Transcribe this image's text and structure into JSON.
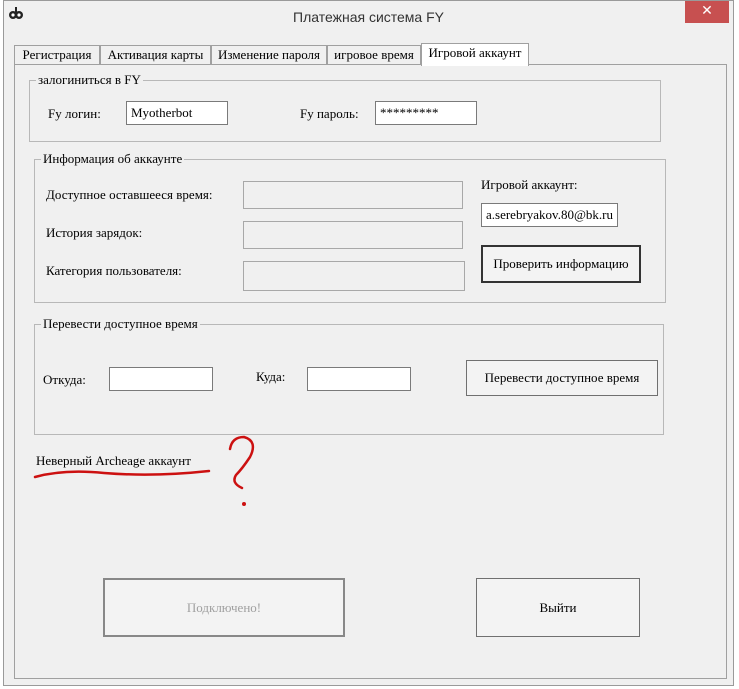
{
  "window": {
    "title": "Платежная система FY",
    "close_glyph": "✕"
  },
  "tabs": [
    {
      "label": "Регистрация"
    },
    {
      "label": "Активация карты"
    },
    {
      "label": "Изменение пароля"
    },
    {
      "label": "игровое время"
    },
    {
      "label": "Игровой аккаунт"
    }
  ],
  "login_group": {
    "legend": "залогиниться в FY",
    "login_label": "Fy логин:",
    "login_value": "Myotherbot",
    "password_label": "Fy пароль:",
    "password_value": "*********"
  },
  "info_group": {
    "legend": "Информация об аккаунте",
    "remaining_time_label": "Доступное оставшееся время:",
    "remaining_time_value": "",
    "recharge_history_label": "История зарядок:",
    "recharge_history_value": "",
    "user_category_label": "Категория пользователя:",
    "user_category_value": "",
    "game_account_label": "Игровой аккаунт:",
    "game_account_value": "a.serebryakov.80@bk.ru",
    "check_button": "Проверить информацию"
  },
  "transfer_group": {
    "legend": "Перевести доступное время",
    "from_label": "Откуда:",
    "from_value": "",
    "to_label": "Куда:",
    "to_value": "",
    "transfer_button": "Перевести доступное время"
  },
  "status": {
    "message": "Неверный Archeage аккаунт"
  },
  "footer": {
    "connect_button": "Подключено!",
    "exit_button": "Выйти"
  },
  "colors": {
    "annotation": "#cc1111",
    "close_button": "#c75050"
  }
}
